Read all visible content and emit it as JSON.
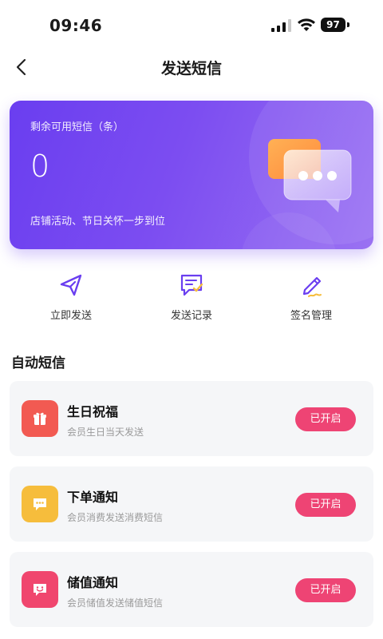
{
  "status_bar": {
    "time": "09:46",
    "battery": "97"
  },
  "header": {
    "title": "发送短信",
    "back_icon": "chevron-left-icon"
  },
  "balance_card": {
    "label": "剩余可用短信（条）",
    "value": "0",
    "subtitle": "店铺活动、节日关怀一步到位",
    "colors": {
      "start": "#6a3ef0",
      "end": "#9a72f2"
    }
  },
  "actions": [
    {
      "label": "立即发送",
      "icon": "send-icon"
    },
    {
      "label": "发送记录",
      "icon": "message-record-icon"
    },
    {
      "label": "签名管理",
      "icon": "signature-pen-icon"
    }
  ],
  "section": {
    "title": "自动短信"
  },
  "sms_items": [
    {
      "title": "生日祝福",
      "desc": "会员生日当天发送",
      "status": "已开启",
      "icon": "gift-icon",
      "color": "#f25a52"
    },
    {
      "title": "下单通知",
      "desc": "会员消费发送消费短信",
      "status": "已开启",
      "icon": "chat-bubble-icon",
      "color": "#f6bd3c"
    },
    {
      "title": "储值通知",
      "desc": "会员储值发送储值短信",
      "status": "已开启",
      "icon": "smile-message-icon",
      "color": "#f0466e"
    }
  ],
  "accent": "#ee4474"
}
